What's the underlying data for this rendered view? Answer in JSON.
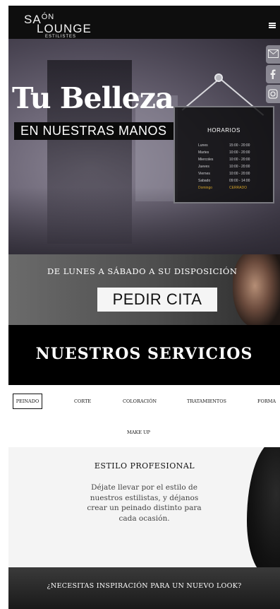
{
  "header": {
    "logo_line1": "SA",
    "logo_on": "ÓN",
    "logo_line2": "LOUNGE",
    "logo_line3": "ESTILISTES",
    "menu_icon": "hamburger-menu-icon"
  },
  "hero": {
    "title": "Tu Belleza",
    "subtitle": "EN NUESTRAS MANOS"
  },
  "hours": {
    "title": "HORARIOS",
    "rows": [
      {
        "day": "Lunes",
        "hours": "15:00 - 20:00"
      },
      {
        "day": "Martes",
        "hours": "10:00 - 20:00"
      },
      {
        "day": "Miercoles",
        "hours": "10:00 - 20:00"
      },
      {
        "day": "Jueves",
        "hours": "10:00 - 20:00"
      },
      {
        "day": "Viernes",
        "hours": "10:00 - 20:00"
      },
      {
        "day": "Sabado",
        "hours": "09:00 - 14:00"
      },
      {
        "day": "Domingo",
        "hours": "CERRADO"
      }
    ]
  },
  "social": {
    "icons": [
      "email-icon",
      "facebook-icon",
      "instagram-icon"
    ]
  },
  "cta": {
    "text": "DE LUNES A SÁBADO A SU DISPOSICIÓN",
    "button": "PEDIR CITA"
  },
  "services": {
    "title": "NUESTROS SERVICIOS",
    "tabs": [
      "PEINADO",
      "CORTE",
      "COLORACIÓN",
      "TRATAMIENTOS",
      "FORMA",
      "MAKE UP"
    ],
    "active_tab": "PEINADO"
  },
  "estilo": {
    "title": "ESTILO PROFESIONAL",
    "body": "Déjate llevar por el estilo de nuestros estilistas, y déjanos crear un peinado distinto para cada ocasión."
  },
  "inspiration": {
    "text": "¿NECESITAS INSPIRACIÓN PARA UN NUEVO LOOK?"
  },
  "colors": {
    "header_bg": "#0e0e0e",
    "closed_accent": "#d4a328",
    "services_bg": "#000000"
  }
}
